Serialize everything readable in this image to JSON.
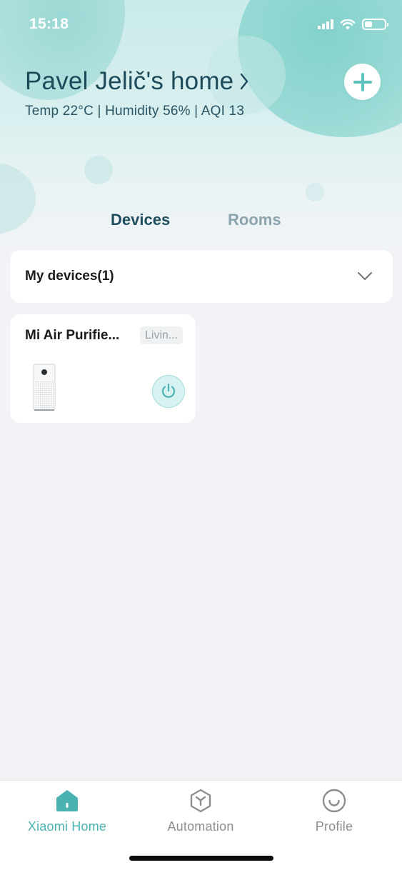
{
  "status_bar": {
    "time": "15:18",
    "battery_level": 0.4
  },
  "header": {
    "home_name": "Pavel Jelič's home",
    "environment": "Temp 22°C | Humidity 56% | AQI 13",
    "add_icon": "plus-icon",
    "chevron_icon": "chevron-right-icon"
  },
  "tabs": [
    {
      "label": "Devices",
      "active": true
    },
    {
      "label": "Rooms",
      "active": false
    }
  ],
  "device_group": {
    "label": "My devices(1)",
    "icon": "chevron-down-icon"
  },
  "devices": [
    {
      "name": "Mi Air Purifie...",
      "room": "Livin...",
      "icon": "air-purifier-image",
      "power_icon": "power-icon"
    }
  ],
  "bottom_nav": [
    {
      "label": "Xiaomi Home",
      "icon": "home-icon",
      "active": true
    },
    {
      "label": "Automation",
      "icon": "automation-icon",
      "active": false
    },
    {
      "label": "Profile",
      "icon": "profile-smile-icon",
      "active": false
    }
  ],
  "colors": {
    "accent": "#4ab3b1",
    "title": "#1d4a59",
    "inactive_tab": "#8aa3ac",
    "background": "#f2f3f7"
  }
}
